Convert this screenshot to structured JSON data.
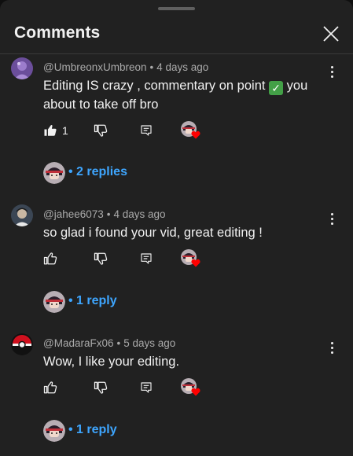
{
  "header": {
    "title": "Comments"
  },
  "comments": [
    {
      "author": "@UmbreonxUmbreon",
      "time": "4 days ago",
      "text_part1": "Editing IS crazy , commentary on point",
      "check_icon": "check-mark-button-emoji",
      "text_part2": "you about to take off bro",
      "like_count": "1",
      "liked": true,
      "replies": "2 replies"
    },
    {
      "author": "@jahee6073",
      "time": "4 days ago",
      "text": "so glad i found your vid, great editing !",
      "like_count": "",
      "liked": false,
      "replies": "1 reply"
    },
    {
      "author": "@MadaraFx06",
      "time": "5 days ago",
      "text": "Wow, I like your editing.",
      "like_count": "",
      "liked": false,
      "replies": "1 reply"
    }
  ],
  "meta_separator": "•",
  "colors": {
    "background": "#212121",
    "text": "#f1f1f1",
    "secondary_text": "#aaaaaa",
    "link": "#3ea6ff",
    "heart": "#ff0000"
  }
}
